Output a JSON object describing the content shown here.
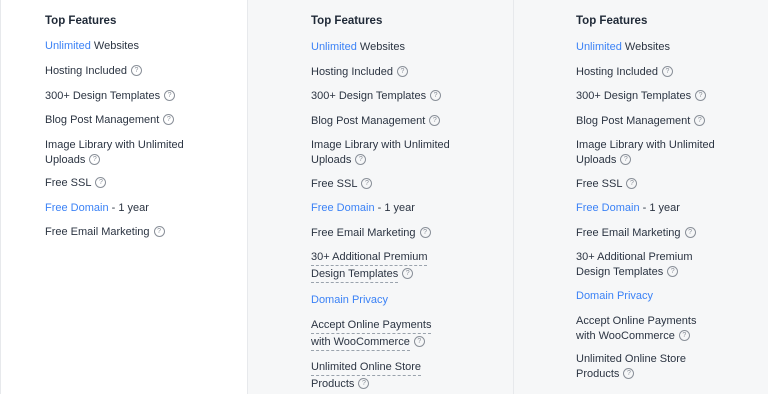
{
  "columns": [
    {
      "title": "Top Features",
      "features": {
        "unlimited_link": "Unlimited",
        "websites": " Websites",
        "hosting": "Hosting Included",
        "templates": "300+ Design Templates",
        "blog": "Blog Post Management",
        "image_library_line1": "Image Library with Unlimited",
        "image_library_line2": "Uploads",
        "ssl": "Free SSL",
        "free_domain_link": "Free Domain",
        "free_domain_suffix": " - 1 year",
        "email": "Free Email Marketing"
      }
    },
    {
      "title": "Top Features",
      "features": {
        "unlimited_link": "Unlimited",
        "websites": " Websites",
        "hosting": "Hosting Included",
        "templates": "300+ Design Templates",
        "blog": "Blog Post Management",
        "image_library_line1": "Image Library with Unlimited",
        "image_library_line2": "Uploads",
        "ssl": "Free SSL",
        "free_domain_link": "Free Domain",
        "free_domain_suffix": " - 1 year",
        "email": "Free Email Marketing",
        "premium_line1": "30+ Additional Premium",
        "premium_line2": "Design Templates",
        "domain_privacy": "Domain Privacy",
        "payments_line1": "Accept Online Payments",
        "payments_line2": "with WooCommerce",
        "store_line1": "Unlimited Online Store",
        "store_line2": "Products"
      }
    },
    {
      "title": "Top Features",
      "features": {
        "unlimited_link": "Unlimited",
        "websites": " Websites",
        "hosting": "Hosting Included",
        "templates": "300+ Design Templates",
        "blog": "Blog Post Management",
        "image_library_line1": "Image Library with Unlimited",
        "image_library_line2": "Uploads",
        "ssl": "Free SSL",
        "free_domain_link": "Free Domain",
        "free_domain_suffix": " - 1 year",
        "email": "Free Email Marketing",
        "premium_line1": "30+ Additional Premium",
        "premium_line2": "Design Templates",
        "domain_privacy": "Domain Privacy",
        "payments_line1": "Accept Online Payments",
        "payments_line2": "with WooCommerce",
        "store_line1": "Unlimited Online Store",
        "store_line2": "Products"
      }
    }
  ],
  "help_icon_glyph": "?",
  "colors": {
    "link": "#3b82f6",
    "text": "#2b3442"
  }
}
